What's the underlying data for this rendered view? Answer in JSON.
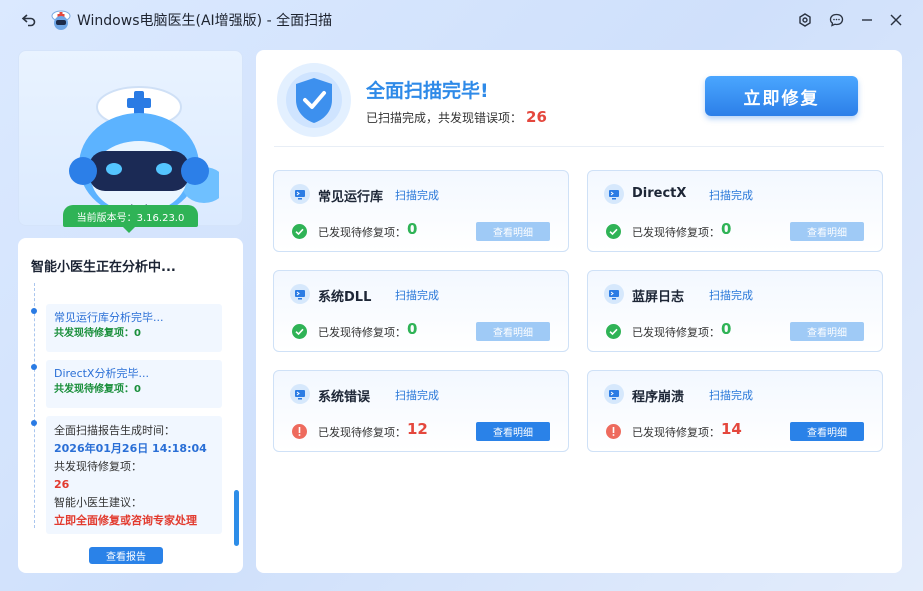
{
  "window": {
    "title": "Windows电脑医生(AI增强版) - 全面扫描"
  },
  "sidebar": {
    "version_label": "当前版本号：3.16.23.0",
    "log_title": "智能小医生正在分析中...",
    "log_items": [
      {
        "title": "常见运行库分析完毕...",
        "sub": "共发现待修复项：0"
      },
      {
        "title": "DirectX分析完毕...",
        "sub": "共发现待修复项：0"
      }
    ],
    "report": {
      "time_label": "全面扫描报告生成时间：",
      "time_value": "2026年01月26日 14:18:04",
      "count_label": "共发现待修复项：",
      "count_value": "26",
      "advice_label": "智能小医生建议：",
      "advice_value": "立即全面修复或咨询专家处理"
    },
    "report_button": "查看报告"
  },
  "summary": {
    "title": "全面扫描完毕!",
    "subtitle": "已扫描完成，共发现错误项：",
    "error_count": "26",
    "fix_button": "立即修复"
  },
  "items": [
    {
      "name": "常见运行库",
      "status": "扫描完成",
      "label": "已发现待修复项：",
      "count": "0",
      "ok": true,
      "button": "查看明细"
    },
    {
      "name": "DirectX",
      "status": "扫描完成",
      "label": "已发现待修复项：",
      "count": "0",
      "ok": true,
      "button": "查看明细"
    },
    {
      "name": "系统DLL",
      "status": "扫描完成",
      "label": "已发现待修复项：",
      "count": "0",
      "ok": true,
      "button": "查看明细"
    },
    {
      "name": "蓝屏日志",
      "status": "扫描完成",
      "label": "已发现待修复项：",
      "count": "0",
      "ok": true,
      "button": "查看明细"
    },
    {
      "name": "系统错误",
      "status": "扫描完成",
      "label": "已发现待修复项：",
      "count": "12",
      "ok": false,
      "button": "查看明细"
    },
    {
      "name": "程序崩溃",
      "status": "扫描完成",
      "label": "已发现待修复项：",
      "count": "14",
      "ok": false,
      "button": "查看明细"
    }
  ],
  "colors": {
    "accent": "#2a82e8",
    "success": "#2fb356",
    "danger": "#e4473d"
  }
}
